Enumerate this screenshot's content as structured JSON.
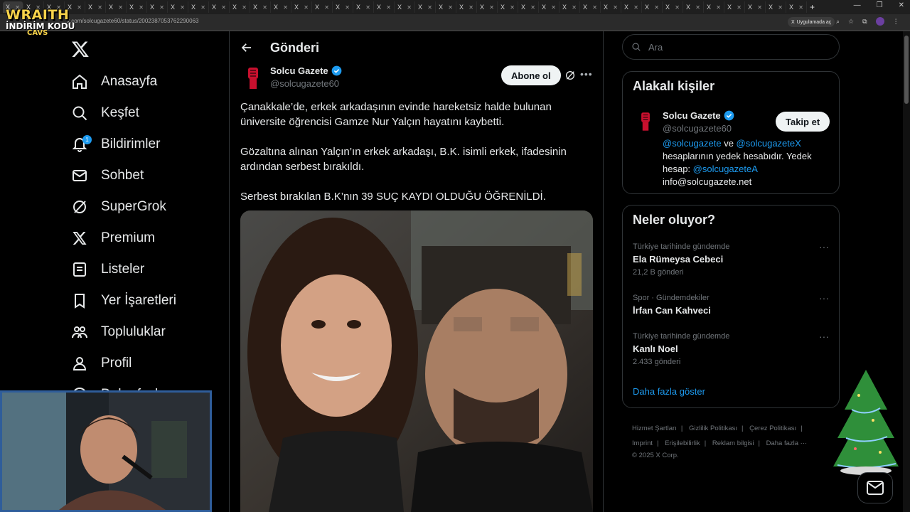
{
  "browser": {
    "url": "x.com/solcugazete60/status/2002387053762290063",
    "open_in_app": "Uygulamada aç",
    "tab_label": "X"
  },
  "overlay": {
    "logo_line1": "WRAITH",
    "logo_line2": "İNDİRİM KODU",
    "logo_line3": "CAVS"
  },
  "nav": {
    "items": [
      {
        "label": "Anasayfa",
        "icon": "home-icon"
      },
      {
        "label": "Keşfet",
        "icon": "search-icon"
      },
      {
        "label": "Bildirimler",
        "icon": "bell-icon",
        "badge": "1"
      },
      {
        "label": "Sohbet",
        "icon": "mail-icon"
      },
      {
        "label": "SuperGrok",
        "icon": "grok-icon"
      },
      {
        "label": "Premium",
        "icon": "x-icon"
      },
      {
        "label": "Listeler",
        "icon": "list-icon"
      },
      {
        "label": "Yer İşaretleri",
        "icon": "bookmark-icon"
      },
      {
        "label": "Topluluklar",
        "icon": "people-icon"
      },
      {
        "label": "Profil",
        "icon": "user-icon"
      },
      {
        "label": "Daha fazla",
        "icon": "more-circle-icon"
      }
    ]
  },
  "main": {
    "title": "Gönderi",
    "author_name": "Solcu Gazete",
    "author_handle": "@solcugazete60",
    "follow_label": "Abone ol",
    "paragraphs": [
      "Çanakkale’de, erkek arkadaşının evinde hareketsiz halde bulunan üniversite öğrencisi Gamze Nur Yalçın hayatını kaybetti.",
      "Gözaltına alınan Yalçın’ın erkek arkadaşı, B.K. isimli erkek, ifadesinin ardından serbest bırakıldı.",
      "Serbest bırakılan B.K’nın 39 SUÇ KAYDI OLDUĞU ÖĞRENİLDİ."
    ]
  },
  "right": {
    "search_placeholder": "Ara",
    "related": {
      "title": "Alakalı kişiler",
      "name": "Solcu Gazete",
      "handle": "@solcugazete60",
      "follow_label": "Takip et",
      "bio_link1": "@solcugazete",
      "bio_and": " ve ",
      "bio_link2": "@solcugazeteX",
      "bio_mid": " hesaplarının yedek hesabıdır. Yedek hesap: ",
      "bio_link3": "@solcugazeteA",
      "bio_email": "info@solcugazete.net"
    },
    "trends": {
      "title": "Neler oluyor?",
      "items": [
        {
          "context": "Türkiye tarihinde gündemde",
          "name": "Ela Rümeysa Cebeci",
          "count": "21,2 B gönderi"
        },
        {
          "context": "Spor · Gündemdekiler",
          "name": "İrfan Can Kahveci",
          "count": ""
        },
        {
          "context": "Türkiye tarihinde gündemde",
          "name": "Kanlı Noel",
          "count": "2.433 gönderi"
        }
      ],
      "show_more": "Daha fazla göster"
    },
    "footer": {
      "links": [
        "Hizmet Şartları",
        "Gizlilik Politikası",
        "Çerez Politikası",
        "Imprint",
        "Erişilebilirlik",
        "Reklam bilgisi",
        "Daha fazla ···"
      ],
      "copyright": "© 2025 X Corp."
    }
  },
  "colors": {
    "accent": "#1d9bf0",
    "background": "#000000",
    "border": "#2f3336",
    "muted": "#71767b"
  }
}
